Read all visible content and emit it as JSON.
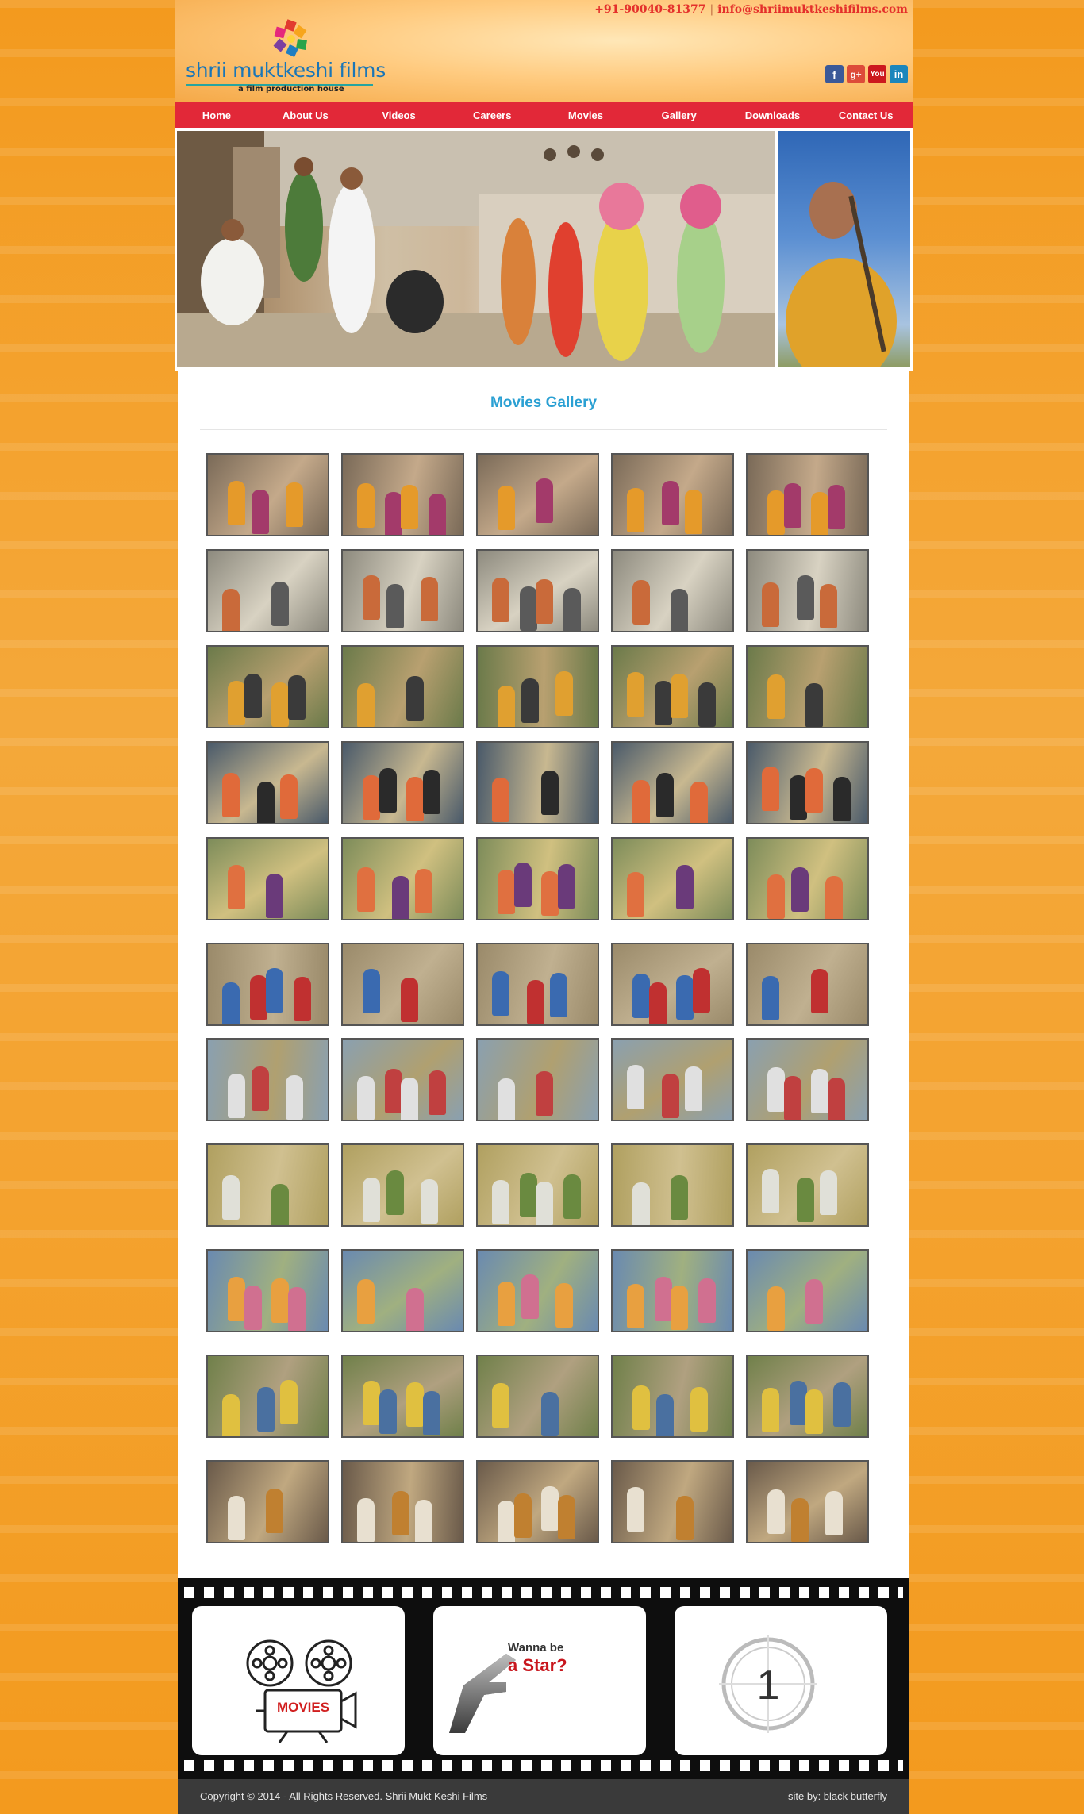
{
  "header": {
    "logo_name": "shrii muktkeshi films",
    "logo_tagline": "a film production house",
    "phone": "+91-90040-81377",
    "separator": "|",
    "email": "info@shriimuktkeshifilms.com",
    "social": [
      {
        "icon": "facebook-icon",
        "glyph": "f"
      },
      {
        "icon": "google-plus-icon",
        "glyph": "g+"
      },
      {
        "icon": "youtube-icon",
        "glyph": "You"
      },
      {
        "icon": "linkedin-icon",
        "glyph": "in"
      }
    ]
  },
  "nav": {
    "items": [
      "Home",
      "About Us",
      "Videos",
      "Careers",
      "Movies",
      "Gallery",
      "Downloads",
      "Contact Us"
    ]
  },
  "gallery": {
    "title": "Movies Gallery",
    "thumbnail_rows": 11,
    "thumbnails_per_row": 5
  },
  "film_strip": {
    "movies_label": "MOVIES",
    "star_line1": "Wanna be",
    "star_line2": "a Star?",
    "countdown": "1"
  },
  "footer": {
    "copyright": "Copyright © 2014 - All Rights Reserved. Shrii Mukt Keshi Films",
    "credit": "site by: black butterfly"
  },
  "colors": {
    "page_bg": "#f39a1e",
    "nav_bg": "#e22838",
    "title": "#2aa0d3",
    "contact": "#e4302b",
    "footer_bg": "#3a3a3a"
  }
}
